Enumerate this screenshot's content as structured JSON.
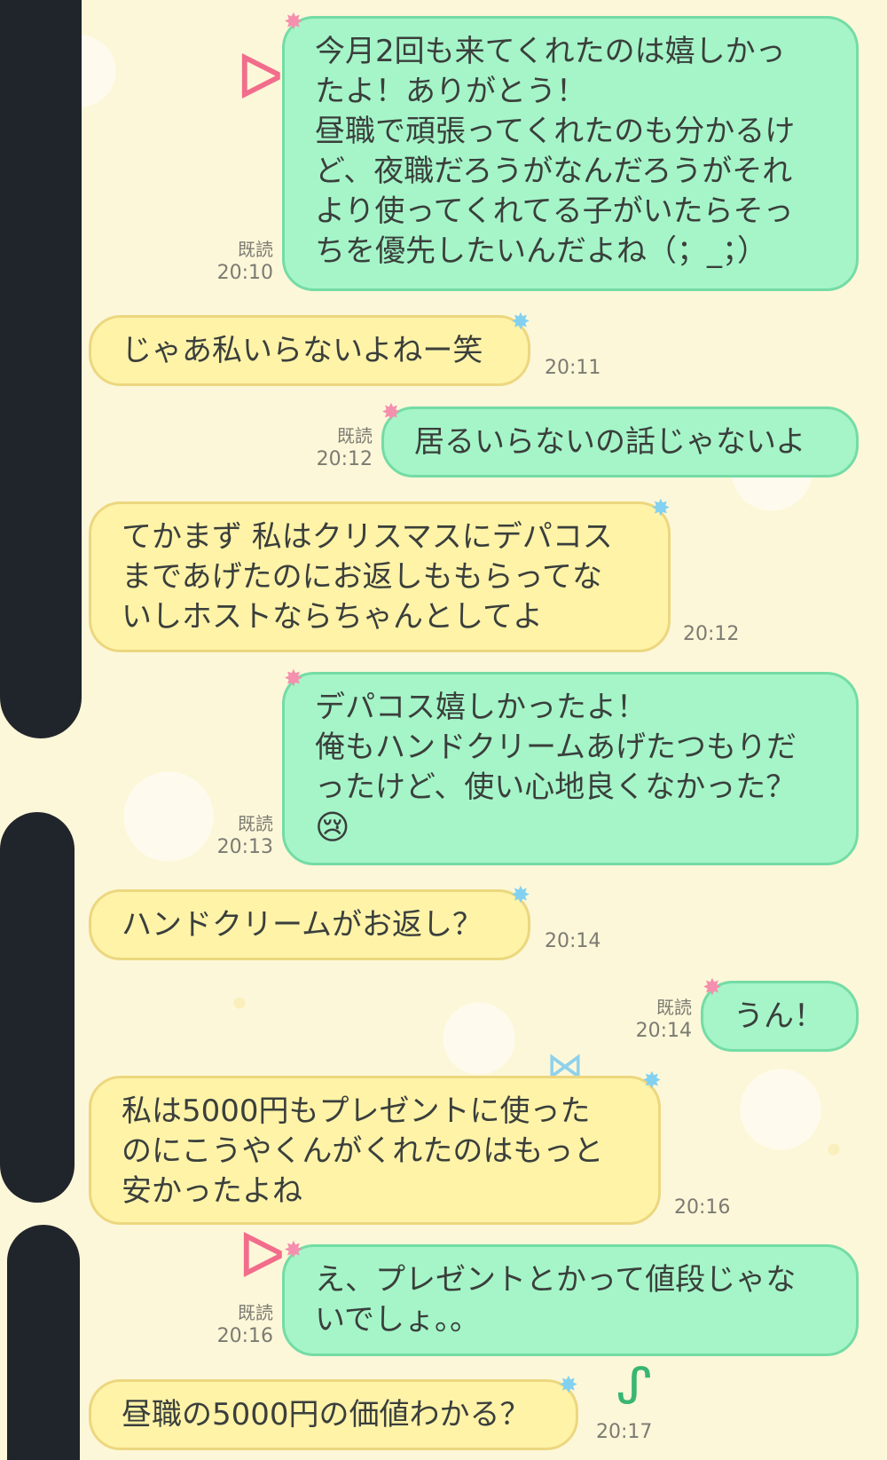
{
  "messages": [
    {
      "sender": "me",
      "lines": [
        "今月2回も来てくれたのは嬉しかっ",
        "たよ！ありがとう！",
        "昼職で頑張ってくれたのも分かるけ",
        "ど、夜職だろうがなんだろうがそれ",
        "より使ってくれてる子がいたらそっ",
        "ちを優先したいんだよね（；_；）"
      ],
      "read": "既読",
      "time": "20:10"
    },
    {
      "sender": "them",
      "lines": [
        "じゃあ私いらないよねー笑"
      ],
      "time": "20:11"
    },
    {
      "sender": "me",
      "lines": [
        "居るいらないの話じゃないよ"
      ],
      "read": "既読",
      "time": "20:12"
    },
    {
      "sender": "them",
      "lines": [
        "てかまず 私はクリスマスにデパコス",
        "まであげたのにお返しももらってな",
        "いしホストならちゃんとしてよ"
      ],
      "time": "20:12"
    },
    {
      "sender": "me",
      "lines": [
        "デパコス嬉しかったよ！",
        "俺もハンドクリームあげたつもりだ",
        "ったけど、使い心地良くなかった？",
        "😢"
      ],
      "read": "既読",
      "time": "20:13"
    },
    {
      "sender": "them",
      "lines": [
        "ハンドクリームがお返し？"
      ],
      "time": "20:14"
    },
    {
      "sender": "me",
      "lines": [
        "うん！"
      ],
      "read": "既読",
      "time": "20:14"
    },
    {
      "sender": "them",
      "lines": [
        "私は5000円もプレゼントに使った",
        "のにこうやくんがくれたのはもっと",
        "安かったよね"
      ],
      "time": "20:16"
    },
    {
      "sender": "me",
      "lines": [
        "え、プレゼントとかって値段じゃな",
        "いでしょ。。"
      ],
      "read": "既読",
      "time": "20:16"
    },
    {
      "sender": "them",
      "lines": [
        "昼職の5000円の価値わかる？"
      ],
      "time": "20:17"
    }
  ],
  "colors": {
    "background": "#fdf7d9",
    "my_bubble": "#a5f5c8",
    "my_bubble_border": "#74dca5",
    "their_bubble": "#fff3a8",
    "their_bubble_border": "#ecd77f",
    "redaction": "#20252b",
    "meta_text": "#7b7b72"
  },
  "icons": {
    "my_bubble_corner": "pink-star",
    "their_bubble_corner": "blue-star",
    "crying_emoji": "😢"
  }
}
